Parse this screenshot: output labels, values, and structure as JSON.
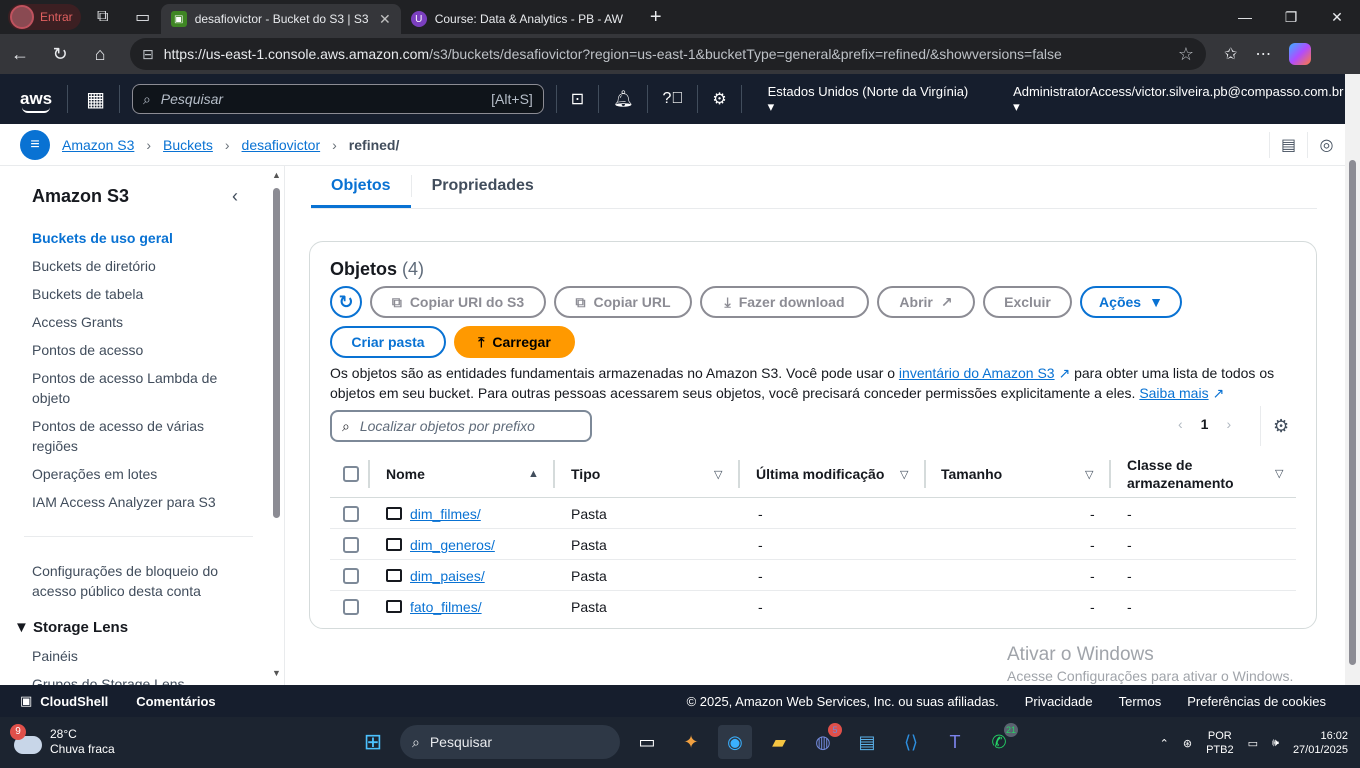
{
  "browser": {
    "profile_label": "Entrar",
    "tabs": [
      {
        "title": "desafiovictor - Bucket do S3 | S3 |",
        "active": true
      },
      {
        "title": "Course: Data & Analytics - PB - AW",
        "active": false
      }
    ],
    "url_host": "https://us-east-1.console.aws.amazon.com",
    "url_path": "/s3/buckets/desafiovictor?region=us-east-1&bucketType=general&prefix=refined/&showversions=false"
  },
  "aws_header": {
    "logo": "aws",
    "search_placeholder": "Pesquisar",
    "search_shortcut": "[Alt+S]",
    "region": "Estados Unidos (Norte da Virgínia)",
    "account": "AdministratorAccess/victor.silveira.pb@compasso.com.br"
  },
  "breadcrumb": {
    "items": [
      "Amazon S3",
      "Buckets",
      "desafiovictor"
    ],
    "current": "refined/"
  },
  "sidebar": {
    "title": "Amazon S3",
    "items": [
      {
        "label": "Buckets de uso geral",
        "active": true
      },
      {
        "label": "Buckets de diretório"
      },
      {
        "label": "Buckets de tabela"
      },
      {
        "label": "Access Grants"
      },
      {
        "label": "Pontos de acesso"
      },
      {
        "label": "Pontos de acesso Lambda de objeto"
      },
      {
        "label": "Pontos de acesso de várias regiões"
      },
      {
        "label": "Operações em lotes"
      },
      {
        "label": "IAM Access Analyzer para S3"
      }
    ],
    "block_config": "Configurações de bloqueio do acesso público desta conta",
    "section_storage_lens": "Storage Lens",
    "storage_items": [
      "Painéis",
      "Grupos do Storage Lens"
    ]
  },
  "tabs": [
    "Objetos",
    "Propriedades"
  ],
  "objects": {
    "title": "Objetos",
    "count": "(4)",
    "buttons": {
      "copy_uri": "Copiar URI do S3",
      "copy_url": "Copiar URL",
      "download": "Fazer download",
      "open": "Abrir",
      "delete": "Excluir",
      "actions": "Ações",
      "create_folder": "Criar pasta",
      "upload": "Carregar"
    },
    "desc_part1": "Os objetos são as entidades fundamentais armazenadas no Amazon S3. Você pode usar o ",
    "desc_link1": "inventário do Amazon S3",
    "desc_part2": " para obter uma lista de todos os objetos em seu bucket. Para outras pessoas acessarem seus objetos, você precisará conceder permissões explicitamente a eles. ",
    "desc_link2": "Saiba mais",
    "filter_placeholder": "Localizar objetos por prefixo",
    "page": "1",
    "columns": [
      "Nome",
      "Tipo",
      "Última modificação",
      "Tamanho",
      "Classe de armazenamento"
    ],
    "rows": [
      {
        "name": "dim_filmes/",
        "type": "Pasta",
        "modified": "-",
        "size": "-",
        "class": "-"
      },
      {
        "name": "dim_generos/",
        "type": "Pasta",
        "modified": "-",
        "size": "-",
        "class": "-"
      },
      {
        "name": "dim_paises/",
        "type": "Pasta",
        "modified": "-",
        "size": "-",
        "class": "-"
      },
      {
        "name": "fato_filmes/",
        "type": "Pasta",
        "modified": "-",
        "size": "-",
        "class": "-"
      }
    ]
  },
  "watermark": {
    "line1": "Ativar o Windows",
    "line2": "Acesse Configurações para ativar o Windows."
  },
  "footer": {
    "cloudshell": "CloudShell",
    "comments": "Comentários",
    "copyright": "© 2025, Amazon Web Services, Inc. ou suas afiliadas.",
    "privacy": "Privacidade",
    "terms": "Termos",
    "cookies": "Preferências de cookies"
  },
  "taskbar": {
    "weather_badge": "9",
    "temp": "28°C",
    "weather": "Chuva fraca",
    "search": "Pesquisar",
    "discord_badge": "5",
    "whatsapp_badge": "21",
    "lang1": "POR",
    "lang2": "PTB2",
    "time": "16:02",
    "date": "27/01/2025"
  },
  "colors": {
    "aws_nav": "#161e2d",
    "link": "#0972d3",
    "upload": "#ff9900"
  }
}
